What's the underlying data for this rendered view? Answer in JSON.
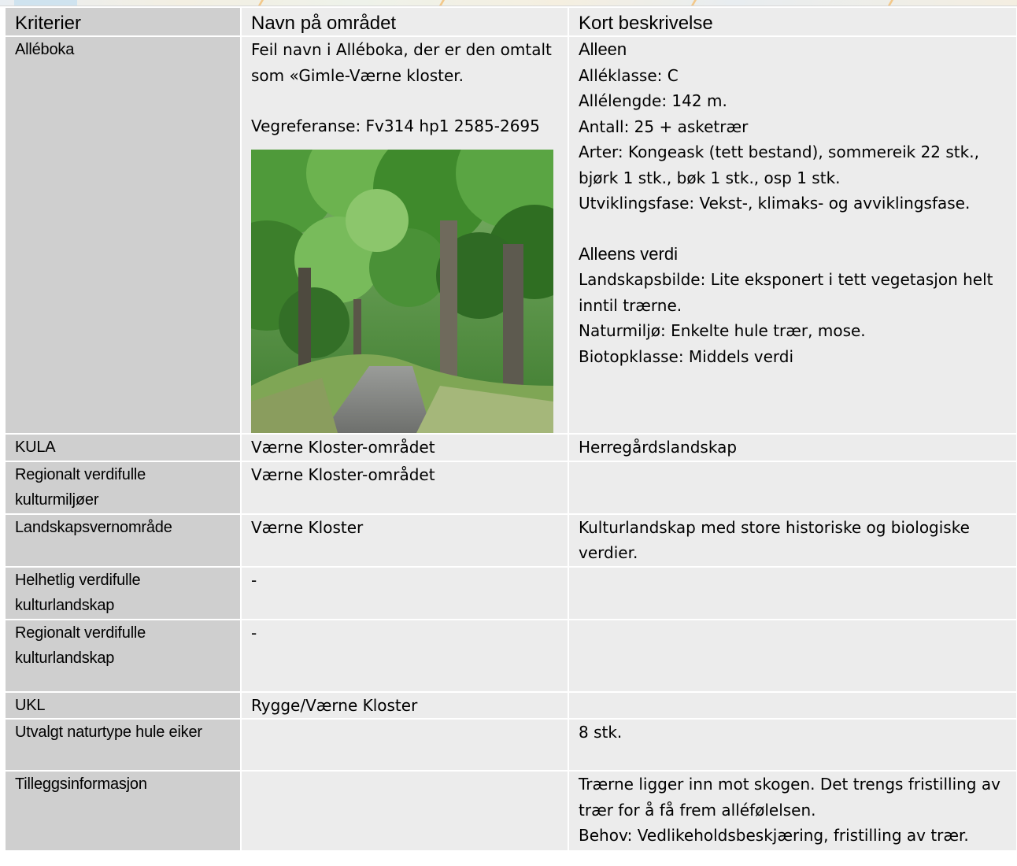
{
  "headers": {
    "col1": "Kriterier",
    "col2": "Navn på området",
    "col3": "Kort beskrivelse"
  },
  "rows": {
    "alleboka": {
      "criterion": "Alléboka",
      "area_line1": "Feil navn i Alléboka, der er den omtalt som «Gimle-Værne kloster.",
      "area_line2": "Vegreferanse: Fv314 hp1 2585-2695",
      "photo_icon": "tree-lined-road-photo",
      "desc_heading1": "Alleen",
      "desc_lines1": [
        "Alléklasse: C",
        "Allélengde: 142 m.",
        "Antall: 25 + asketrær",
        "Arter: Kongeask (tett bestand), sommereik 22 stk., bjørk 1 stk., bøk 1 stk., osp 1 stk.",
        "Utviklingsfase: Vekst-, klimaks- og avviklingsfase."
      ],
      "desc_heading2": "Alleens verdi",
      "desc_lines2": [
        "Landskapsbilde: Lite eksponert i tett vegetasjon helt inntil trærne.",
        "Naturmiljø: Enkelte hule trær, mose.",
        "Biotopklasse: Middels verdi"
      ]
    },
    "kula": {
      "criterion": "KULA",
      "area": "Værne Kloster-området",
      "desc": "Herregårdslandskap"
    },
    "regionalt_miljo": {
      "criterion": "Regionalt verdifulle kulturmiljøer",
      "area": "Værne Kloster-området",
      "desc": ""
    },
    "landskapsvern": {
      "criterion": "Landskapsvernområde",
      "area": "Værne Kloster",
      "desc": "Kulturlandskap med store historiske og biologiske verdier."
    },
    "helhetlig": {
      "criterion": "Helhetlig verdifulle kulturlandskap",
      "area": "-",
      "desc": ""
    },
    "regionalt_landskap": {
      "criterion": "Regionalt verdifulle kulturlandskap",
      "area": "-",
      "desc": ""
    },
    "ukl": {
      "criterion": "UKL",
      "area": "Rygge/Værne Kloster",
      "desc": ""
    },
    "hule_eiker": {
      "criterion": "Utvalgt naturtype hule eiker",
      "area": "",
      "desc": "8 stk."
    },
    "tillegg": {
      "criterion": "Tilleggsinformasjon",
      "area": "",
      "desc_line1": "Trærne ligger inn mot skogen. Det trengs fristilling av trær for å få frem alléfølelsen.",
      "desc_line2": "Behov: Vedlikeholdsbeskjæring, fristilling av trær."
    }
  },
  "colors": {
    "criterion_bg": "#cfcfcf",
    "cell_bg": "#ececec"
  }
}
